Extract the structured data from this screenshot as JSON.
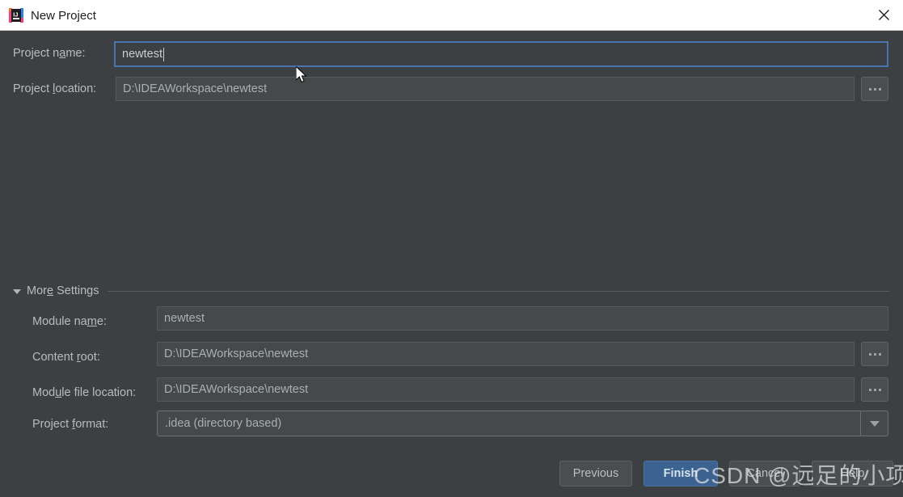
{
  "window": {
    "title": "New Project",
    "app_icon": "intellij-idea-icon",
    "close_icon": "close-icon",
    "accent_focus_color": "#4b76ad",
    "primary_button_color": "#3c638f",
    "background_color": "#3c4043",
    "titlebar_color": "#ffffff"
  },
  "form": {
    "project_name": {
      "label_before": "Project n",
      "label_mnemonic": "a",
      "label_after": "me:",
      "value": "newtest",
      "focused": true
    },
    "project_location": {
      "label_before": "Project ",
      "label_mnemonic": "l",
      "label_after": "ocation:",
      "value": "D:\\IDEAWorkspace\\newtest",
      "browse_label": "...",
      "browse_icon": "ellipsis-icon"
    }
  },
  "more_settings": {
    "label_before": "Mor",
    "label_mnemonic": "e",
    "label_after": " Settings",
    "expanded": true,
    "toggle_icon": "chevron-down-icon",
    "fields": {
      "module_name": {
        "label_before": "Module na",
        "label_mnemonic": "m",
        "label_after": "e:",
        "value": "newtest"
      },
      "content_root": {
        "label_before": "Content ",
        "label_mnemonic": "r",
        "label_after": "oot:",
        "value": "D:\\IDEAWorkspace\\newtest",
        "browse_icon": "ellipsis-icon"
      },
      "module_file_location": {
        "label_before": "Mod",
        "label_mnemonic": "u",
        "label_after": "le file location:",
        "value": "D:\\IDEAWorkspace\\newtest",
        "browse_icon": "ellipsis-icon"
      },
      "project_format": {
        "label_before": "Project ",
        "label_mnemonic": "f",
        "label_after": "ormat:",
        "value": ".idea (directory based)",
        "dropdown_icon": "triangle-down-icon"
      }
    }
  },
  "buttons": {
    "previous": "Previous",
    "finish": "Finish",
    "cancel": "Cancel",
    "help": "Help"
  },
  "watermark": {
    "text": "CSDN @远足的小项"
  }
}
